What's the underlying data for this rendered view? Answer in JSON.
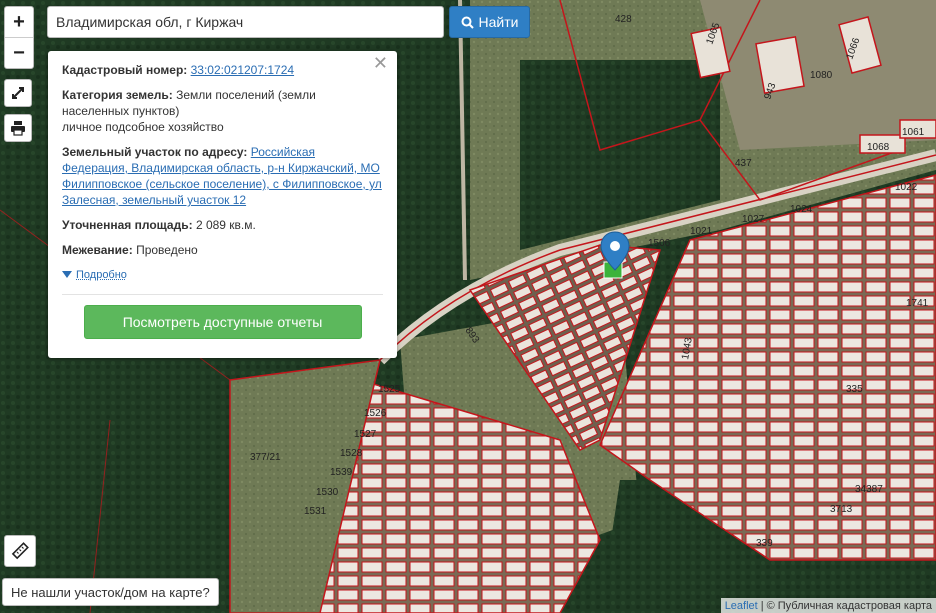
{
  "search": {
    "value": "Владимирская обл, г Киржач",
    "button_label": "Найти",
    "button_icon": "search-icon"
  },
  "zoom": {
    "in": "+",
    "out": "−"
  },
  "controls": {
    "fullscreen_icon": "expand-icon",
    "print_icon": "print-icon",
    "ruler_icon": "ruler-icon"
  },
  "popup": {
    "cad_label": "Кадастровый номер:",
    "cad_value": "33:02:021207:1724",
    "cat_label": "Категория земель:",
    "cat_value": "Земли поселений (земли населенных пунктов)",
    "use_value": "личное подсобное хозяйство",
    "addr_label": "Земельный участок по адресу:",
    "addr_value": "Российская Федерация, Владимирская область, р-н Киржачский, МО Филипповское (сельское поселение), с Филипповское, ул Залесная, земельный участок 12",
    "area_label": "Уточненная площадь:",
    "area_value": "2 089 кв.м.",
    "mezh_label": "Межевание:",
    "mezh_value": "Проведено",
    "more_label": "Подробно",
    "report_button": "Посмотреть доступные отчеты"
  },
  "not_found_label": "Не нашли участок/дом на карте?",
  "attribution": {
    "leaflet": "Leaflet",
    "sep": "|",
    "copyright": "© Публичная кадастровая карта"
  },
  "map_labels": {
    "l428": "428",
    "l1065": "1065",
    "l1080": "1080",
    "l1066": "1066",
    "l943": "943",
    "l1068": "1068",
    "l1061": "1061",
    "l437": "437",
    "l1022": "1022",
    "l1024": "1024",
    "l1027": "1027",
    "l1021": "1021",
    "l1506": "1506",
    "l1741": "1741",
    "l893": "893",
    "l1043": "1043",
    "l1525": "1525",
    "l1526": "1526",
    "l1527": "1527",
    "l1528": "1528",
    "l1539": "1539",
    "l1530": "1530",
    "l1531": "1531",
    "l37721": "377/21",
    "l335": "335",
    "l339": "339",
    "l34387": "34387",
    "l3713": "3713"
  },
  "colors": {
    "parcel_border": "#c4161c",
    "pin": "#2f7fc5",
    "marker_green": "#3bb33b"
  }
}
